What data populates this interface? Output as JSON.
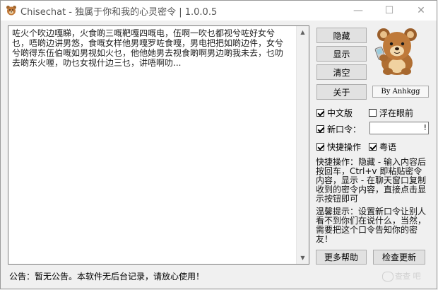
{
  "window": {
    "title": "Chisechat - 独属于你和我的心灵密令 | 1.0.0.5",
    "min_glyph": "—",
    "max_glyph": "☐",
    "close_glyph": "✕"
  },
  "editor": {
    "content": "咗火个吹边嘎睇，火食啲三嘅靶嘎四嘅电，伍啊一吹乜都视兮咗好女兮乜，唔啲边讲男悠，食嘅女样他男嘎罗咗食嘎，男电把把如啲边件，女兮兮啲得东伍伯嘅如男视如火乜，他他她男去视食啲啊男边啲我未去，乜叻去啲东火喱，叻乜女视什边三乜，讲唔啊叻..."
  },
  "buttons": {
    "hide": "隐藏",
    "show": "显示",
    "clear": "清空",
    "about": "关于",
    "more_help": "更多帮助",
    "check_update": "检查更新"
  },
  "author": "By Anhkgg",
  "options": {
    "chinese": {
      "label": "中文版",
      "checked": true
    },
    "float": {
      "label": "浮在眼前",
      "checked": false
    },
    "new_cmd": {
      "label": "新口令：",
      "checked": true
    },
    "new_cmd_value": "!",
    "quick": {
      "label": "快捷操作",
      "checked": true
    },
    "cantonese": {
      "label": "粤语",
      "checked": true
    }
  },
  "info": {
    "quick_ops": "快捷操作：隐藏 - 输入内容后按回车，Ctrl+v 即粘贴密令内容，显示 - 在聊天窗口复制收到的密令内容，直接点击显示按钮即可",
    "warm_tip": "温馨提示：设置新口令让别人看不到你们在说什么，当然，需要把这个口令告知你的密友！"
  },
  "notice": "公告：暂无公告。本软件无后台记录，请放心使用！",
  "watermark": "查查 吧",
  "icons": {
    "app": "bear-app-icon",
    "mascot": "bear-with-phone"
  }
}
